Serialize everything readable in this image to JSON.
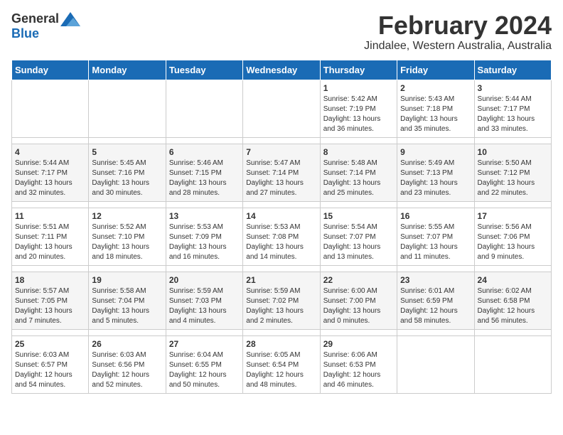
{
  "logo": {
    "general": "General",
    "blue": "Blue"
  },
  "title": {
    "month_year": "February 2024",
    "location": "Jindalee, Western Australia, Australia"
  },
  "headers": [
    "Sunday",
    "Monday",
    "Tuesday",
    "Wednesday",
    "Thursday",
    "Friday",
    "Saturday"
  ],
  "weeks": [
    [
      {
        "day": "",
        "info": ""
      },
      {
        "day": "",
        "info": ""
      },
      {
        "day": "",
        "info": ""
      },
      {
        "day": "",
        "info": ""
      },
      {
        "day": "1",
        "info": "Sunrise: 5:42 AM\nSunset: 7:19 PM\nDaylight: 13 hours\nand 36 minutes."
      },
      {
        "day": "2",
        "info": "Sunrise: 5:43 AM\nSunset: 7:18 PM\nDaylight: 13 hours\nand 35 minutes."
      },
      {
        "day": "3",
        "info": "Sunrise: 5:44 AM\nSunset: 7:17 PM\nDaylight: 13 hours\nand 33 minutes."
      }
    ],
    [
      {
        "day": "4",
        "info": "Sunrise: 5:44 AM\nSunset: 7:17 PM\nDaylight: 13 hours\nand 32 minutes."
      },
      {
        "day": "5",
        "info": "Sunrise: 5:45 AM\nSunset: 7:16 PM\nDaylight: 13 hours\nand 30 minutes."
      },
      {
        "day": "6",
        "info": "Sunrise: 5:46 AM\nSunset: 7:15 PM\nDaylight: 13 hours\nand 28 minutes."
      },
      {
        "day": "7",
        "info": "Sunrise: 5:47 AM\nSunset: 7:14 PM\nDaylight: 13 hours\nand 27 minutes."
      },
      {
        "day": "8",
        "info": "Sunrise: 5:48 AM\nSunset: 7:14 PM\nDaylight: 13 hours\nand 25 minutes."
      },
      {
        "day": "9",
        "info": "Sunrise: 5:49 AM\nSunset: 7:13 PM\nDaylight: 13 hours\nand 23 minutes."
      },
      {
        "day": "10",
        "info": "Sunrise: 5:50 AM\nSunset: 7:12 PM\nDaylight: 13 hours\nand 22 minutes."
      }
    ],
    [
      {
        "day": "11",
        "info": "Sunrise: 5:51 AM\nSunset: 7:11 PM\nDaylight: 13 hours\nand 20 minutes."
      },
      {
        "day": "12",
        "info": "Sunrise: 5:52 AM\nSunset: 7:10 PM\nDaylight: 13 hours\nand 18 minutes."
      },
      {
        "day": "13",
        "info": "Sunrise: 5:53 AM\nSunset: 7:09 PM\nDaylight: 13 hours\nand 16 minutes."
      },
      {
        "day": "14",
        "info": "Sunrise: 5:53 AM\nSunset: 7:08 PM\nDaylight: 13 hours\nand 14 minutes."
      },
      {
        "day": "15",
        "info": "Sunrise: 5:54 AM\nSunset: 7:07 PM\nDaylight: 13 hours\nand 13 minutes."
      },
      {
        "day": "16",
        "info": "Sunrise: 5:55 AM\nSunset: 7:07 PM\nDaylight: 13 hours\nand 11 minutes."
      },
      {
        "day": "17",
        "info": "Sunrise: 5:56 AM\nSunset: 7:06 PM\nDaylight: 13 hours\nand 9 minutes."
      }
    ],
    [
      {
        "day": "18",
        "info": "Sunrise: 5:57 AM\nSunset: 7:05 PM\nDaylight: 13 hours\nand 7 minutes."
      },
      {
        "day": "19",
        "info": "Sunrise: 5:58 AM\nSunset: 7:04 PM\nDaylight: 13 hours\nand 5 minutes."
      },
      {
        "day": "20",
        "info": "Sunrise: 5:59 AM\nSunset: 7:03 PM\nDaylight: 13 hours\nand 4 minutes."
      },
      {
        "day": "21",
        "info": "Sunrise: 5:59 AM\nSunset: 7:02 PM\nDaylight: 13 hours\nand 2 minutes."
      },
      {
        "day": "22",
        "info": "Sunrise: 6:00 AM\nSunset: 7:00 PM\nDaylight: 13 hours\nand 0 minutes."
      },
      {
        "day": "23",
        "info": "Sunrise: 6:01 AM\nSunset: 6:59 PM\nDaylight: 12 hours\nand 58 minutes."
      },
      {
        "day": "24",
        "info": "Sunrise: 6:02 AM\nSunset: 6:58 PM\nDaylight: 12 hours\nand 56 minutes."
      }
    ],
    [
      {
        "day": "25",
        "info": "Sunrise: 6:03 AM\nSunset: 6:57 PM\nDaylight: 12 hours\nand 54 minutes."
      },
      {
        "day": "26",
        "info": "Sunrise: 6:03 AM\nSunset: 6:56 PM\nDaylight: 12 hours\nand 52 minutes."
      },
      {
        "day": "27",
        "info": "Sunrise: 6:04 AM\nSunset: 6:55 PM\nDaylight: 12 hours\nand 50 minutes."
      },
      {
        "day": "28",
        "info": "Sunrise: 6:05 AM\nSunset: 6:54 PM\nDaylight: 12 hours\nand 48 minutes."
      },
      {
        "day": "29",
        "info": "Sunrise: 6:06 AM\nSunset: 6:53 PM\nDaylight: 12 hours\nand 46 minutes."
      },
      {
        "day": "",
        "info": ""
      },
      {
        "day": "",
        "info": ""
      }
    ]
  ]
}
